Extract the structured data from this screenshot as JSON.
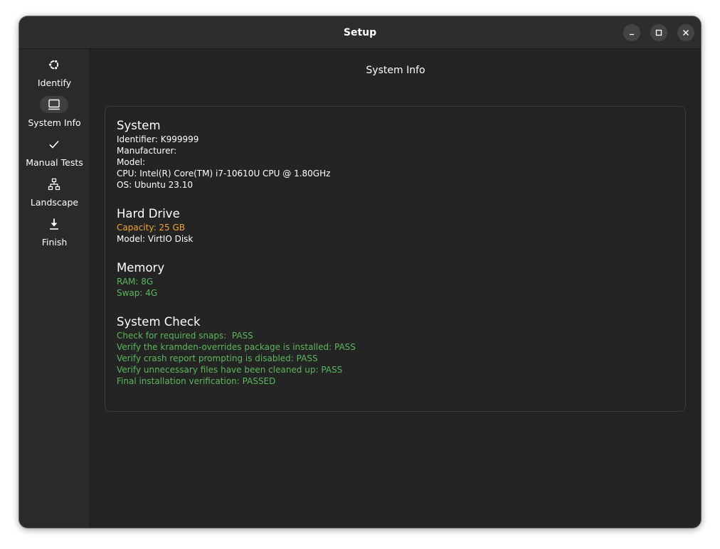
{
  "window": {
    "title": "Setup"
  },
  "sidebar": {
    "items": [
      {
        "label": "Identify",
        "icon": "ubuntu-logo-icon",
        "active": false
      },
      {
        "label": "System Info",
        "icon": "computer-icon",
        "active": true
      },
      {
        "label": "Manual Tests",
        "icon": "checkmark-icon",
        "active": false
      },
      {
        "label": "Landscape",
        "icon": "network-tree-icon",
        "active": false
      },
      {
        "label": "Finish",
        "icon": "download-icon",
        "active": false
      }
    ]
  },
  "page": {
    "title": "System Info"
  },
  "system": {
    "heading": "System",
    "lines": [
      "Identifier: K999999",
      "Manufacturer:",
      "Model:",
      "CPU: Intel(R) Core(TM) i7-10610U CPU @ 1.80GHz",
      "OS: Ubuntu 23.10"
    ]
  },
  "hard_drive": {
    "heading": "Hard Drive",
    "lines": [
      "Capacity: 25 GB",
      "Model: VirtIO Disk"
    ]
  },
  "memory": {
    "heading": "Memory",
    "lines": [
      "RAM: 8G",
      "Swap: 4G"
    ]
  },
  "system_check": {
    "heading": "System Check",
    "lines": [
      "Check for required snaps:  PASS",
      "Verify the kramden-overrides package is installed: PASS",
      "Verify crash report prompting is disabled: PASS",
      "Verify unnecessary files have been cleaned up: PASS",
      "Final installation verification: PASSED"
    ]
  },
  "colors": {
    "warning": "#f2a43a",
    "pass": "#5db65d",
    "window_bg": "#242424",
    "sidebar_bg": "#2a2a2a"
  }
}
